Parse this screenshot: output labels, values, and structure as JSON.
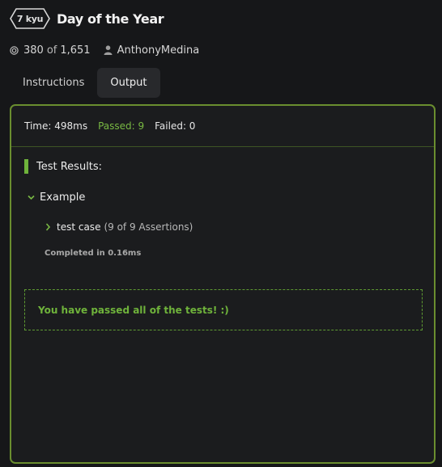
{
  "kata": {
    "rank_label": "7 kyu",
    "title": "Day of the Year",
    "completions_count": "380",
    "completions_of": "of",
    "completions_total": "1,651",
    "author": "AnthonyMedina"
  },
  "icons": {
    "completions": "target-icon",
    "author": "user-icon",
    "expand": "chevron-down-icon",
    "collapsed": "chevron-right-icon"
  },
  "tabs": [
    {
      "label": "Instructions",
      "active": false
    },
    {
      "label": "Output",
      "active": true
    }
  ],
  "output": {
    "time_label": "Time: 498ms",
    "passed_label": "Passed: 9",
    "failed_label": "Failed: 0",
    "results_heading": "Test Results:",
    "group_name": "Example",
    "test_name": "test case",
    "test_assertions": "(9 of 9 Assertions)",
    "completed_text": "Completed in 0.16ms",
    "success_message": "You have passed all of the tests! :)"
  },
  "colors": {
    "accent_green": "#6fb33b",
    "panel_border": "#6a8e2f",
    "background": "#161719"
  }
}
